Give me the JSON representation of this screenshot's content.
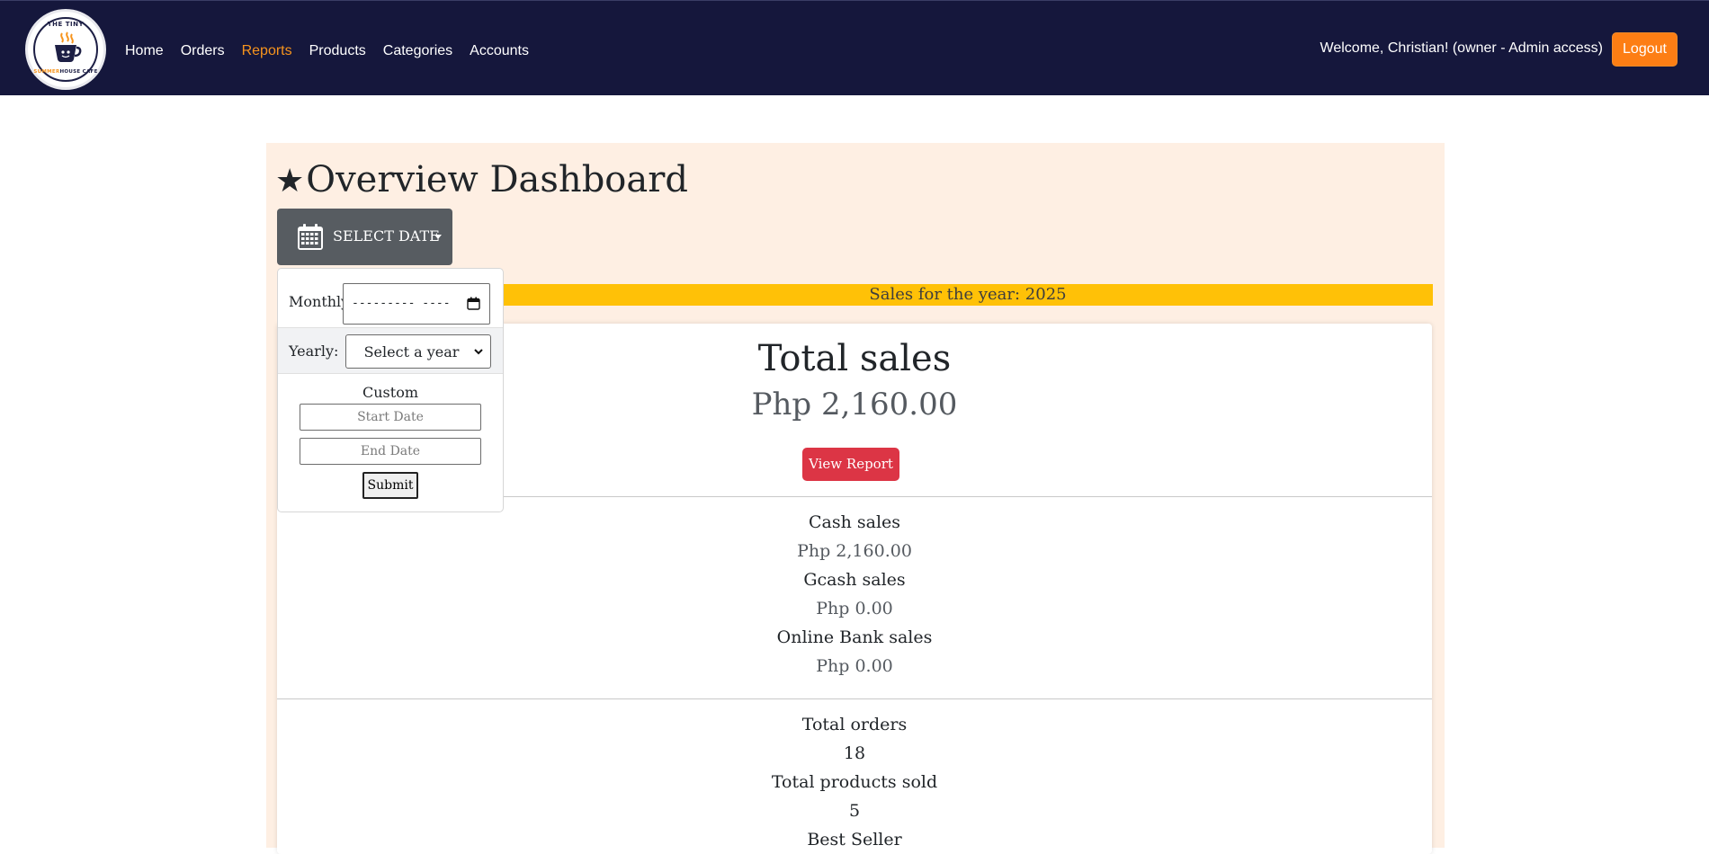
{
  "brand": {
    "logo_top_text": "THE TINY",
    "logo_bottom_text_highlight": "SUMMER",
    "logo_bottom_text_rest": "HOUSE CAFE"
  },
  "nav": {
    "items": [
      {
        "label": "Home",
        "active": false
      },
      {
        "label": "Orders",
        "active": false
      },
      {
        "label": "Reports",
        "active": true
      },
      {
        "label": "Products",
        "active": false
      },
      {
        "label": "Categories",
        "active": false
      },
      {
        "label": "Accounts",
        "active": false
      }
    ],
    "welcome": "Welcome, Christian! (owner - Admin access)",
    "logout_label": "Logout"
  },
  "dashboard": {
    "star_glyph": "★",
    "title": "Overview Dashboard",
    "select_date_label": "SELECT DATE",
    "year_banner": "Sales for the year: 2025",
    "total_sales_heading": "Total sales",
    "total_sales_value": "Php 2,160.00",
    "view_report_label": "View Report",
    "payment_breakdown": [
      {
        "label": "Cash sales",
        "value": "Php 2,160.00"
      },
      {
        "label": "Gcash sales",
        "value": "Php 0.00"
      },
      {
        "label": "Online Bank sales",
        "value": "Php 0.00"
      }
    ],
    "totals": [
      {
        "label": "Total orders",
        "value": "18"
      },
      {
        "label": "Total products sold",
        "value": "5"
      },
      {
        "label": "Best Seller",
        "value": ""
      }
    ]
  },
  "date_menu": {
    "monthly_label": "Monthly:",
    "monthly_value": "--------- ----",
    "yearly_label": "Yearly:",
    "yearly_selected": "Select a year",
    "custom_label": "Custom",
    "start_placeholder": "Start Date",
    "end_placeholder": "End Date",
    "submit_label": "Submit"
  },
  "colors": {
    "navbar_bg": "#15173c",
    "active_nav": "#f7941d",
    "logout_bg": "#fd7e14",
    "panel_bg": "#feefe3",
    "year_banner_bg": "#ffc107",
    "view_report_bg": "#dc3545",
    "select_date_bg": "#575c61"
  },
  "icons": {
    "logo": "cafe-logo",
    "calendar": "calendar-icon",
    "caret": "caret-down-icon",
    "month_picker": "calendar-small-icon",
    "select_chevron": "chevron-down-icon"
  }
}
